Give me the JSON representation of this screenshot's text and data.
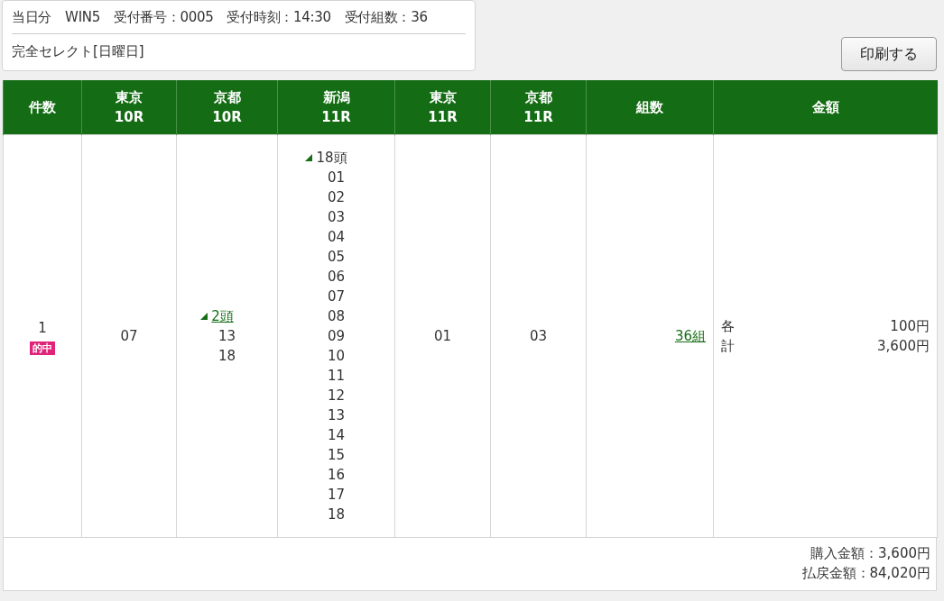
{
  "receipt": {
    "items": [
      "当日分",
      "WIN5",
      "受付番号：0005",
      "受付時刻：14:30",
      "受付組数：36"
    ],
    "bet_type": "完全セレクト[日曜日]"
  },
  "print_button": "印刷する",
  "table": {
    "columns": [
      {
        "lines": [
          "件数"
        ]
      },
      {
        "lines": [
          "東京",
          "10R"
        ]
      },
      {
        "lines": [
          "京都",
          "10R"
        ]
      },
      {
        "lines": [
          "新潟",
          "11R"
        ]
      },
      {
        "lines": [
          "東京",
          "11R"
        ]
      },
      {
        "lines": [
          "京都",
          "11R"
        ]
      },
      {
        "lines": [
          "組数"
        ]
      },
      {
        "lines": [
          "金額"
        ]
      }
    ],
    "rows": [
      {
        "count": "1",
        "hit": true,
        "hit_label": "的中",
        "selections": [
          {
            "kind": "single",
            "text": "07"
          },
          {
            "kind": "group",
            "count": "2頭",
            "linked": true,
            "expanded": true,
            "horses": [
              "13",
              "18"
            ]
          },
          {
            "kind": "group",
            "count": "18頭",
            "linked": false,
            "expanded": true,
            "horses": [
              "01",
              "02",
              "03",
              "04",
              "05",
              "06",
              "07",
              "08",
              "09",
              "10",
              "11",
              "12",
              "13",
              "14",
              "15",
              "16",
              "17",
              "18"
            ]
          },
          {
            "kind": "single",
            "text": "01"
          },
          {
            "kind": "single",
            "text": "03"
          }
        ],
        "combinations": "36組",
        "amounts": [
          {
            "label": "各",
            "value": "100円"
          },
          {
            "label": "計",
            "value": "3,600円"
          }
        ]
      }
    ]
  },
  "totals": [
    "購入金額：3,600円",
    "払戻金額：84,020円"
  ]
}
